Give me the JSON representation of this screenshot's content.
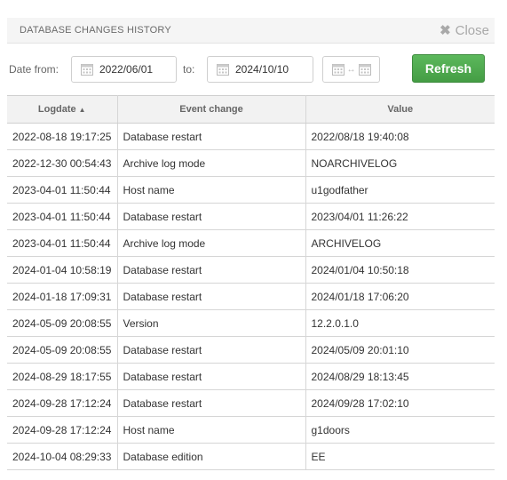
{
  "header": {
    "title": "DATABASE CHANGES HISTORY",
    "close_label": "Close"
  },
  "toolbar": {
    "date_from_label": "Date from:",
    "date_from_value": "2022/06/01",
    "to_label": "to:",
    "date_to_value": "2024/10/10",
    "range_separator": "↔",
    "refresh_label": "Refresh"
  },
  "table": {
    "columns": [
      "Logdate",
      "Event change",
      "Value"
    ],
    "sort_indicator": "▲",
    "rows": [
      [
        "2022-08-18 19:17:25",
        "Database restart",
        "2022/08/18 19:40:08"
      ],
      [
        "2022-12-30 00:54:43",
        "Archive log mode",
        "NOARCHIVELOG"
      ],
      [
        "2023-04-01 11:50:44",
        "Host name",
        "u1godfather"
      ],
      [
        "2023-04-01 11:50:44",
        "Database restart",
        "2023/04/01 11:26:22"
      ],
      [
        "2023-04-01 11:50:44",
        "Archive log mode",
        "ARCHIVELOG"
      ],
      [
        "2024-01-04 10:58:19",
        "Database restart",
        "2024/01/04 10:50:18"
      ],
      [
        "2024-01-18 17:09:31",
        "Database restart",
        "2024/01/18 17:06:20"
      ],
      [
        "2024-05-09 20:08:55",
        "Version",
        "12.2.0.1.0"
      ],
      [
        "2024-05-09 20:08:55",
        "Database restart",
        "2024/05/09 20:01:10"
      ],
      [
        "2024-08-29 18:17:55",
        "Database restart",
        "2024/08/29 18:13:45"
      ],
      [
        "2024-09-28 17:12:24",
        "Database restart",
        "2024/09/28 17:02:10"
      ],
      [
        "2024-09-28 17:12:24",
        "Host name",
        "g1doors"
      ],
      [
        "2024-10-04 08:29:33",
        "Database edition",
        "EE"
      ]
    ]
  },
  "colors": {
    "refresh_bg": "#4cae4c",
    "header_bg": "#f5f5f5"
  },
  "icons": {
    "close": "close-icon",
    "calendar": "calendar-icon"
  }
}
